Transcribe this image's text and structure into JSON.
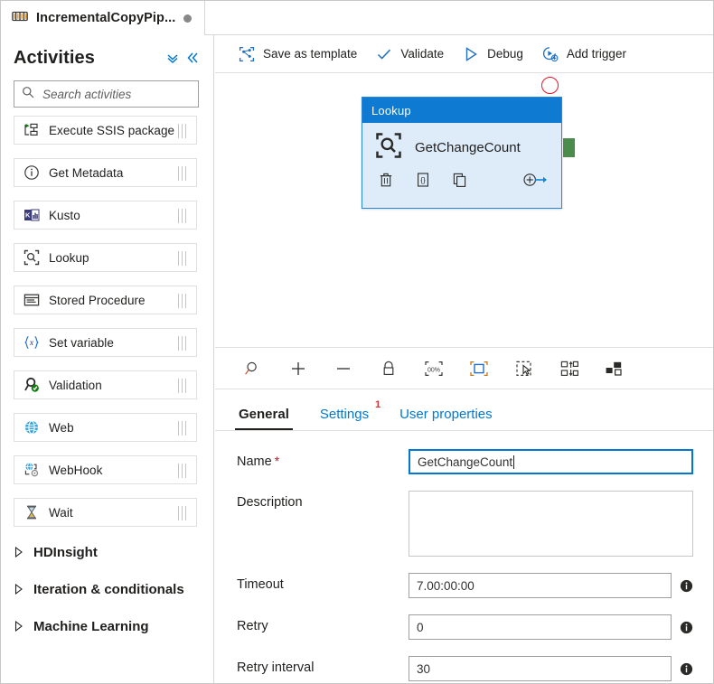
{
  "window": {
    "pipeline_tab_label": "IncrementalCopyPip...",
    "pipeline_tab_icon": "pipeline-icon",
    "unsaved_indicator": "dirty-dot"
  },
  "sidebar": {
    "title": "Activities",
    "collapse_all_icon": "chevron-double-down-icon",
    "collapse_pane_icon": "chevron-double-left-icon",
    "search": {
      "placeholder": "Search activities",
      "value": "",
      "icon": "search-icon"
    },
    "items": [
      {
        "label": "Execute SSIS package",
        "icon": "execute-ssis-package-icon"
      },
      {
        "label": "Get Metadata",
        "icon": "get-metadata-icon"
      },
      {
        "label": "Kusto",
        "icon": "kusto-icon"
      },
      {
        "label": "Lookup",
        "icon": "lookup-icon"
      },
      {
        "label": "Stored Procedure",
        "icon": "stored-procedure-icon"
      },
      {
        "label": "Set variable",
        "icon": "set-variable-icon"
      },
      {
        "label": "Validation",
        "icon": "validation-icon"
      },
      {
        "label": "Web",
        "icon": "web-icon"
      },
      {
        "label": "WebHook",
        "icon": "webhook-icon"
      },
      {
        "label": "Wait",
        "icon": "wait-icon"
      }
    ],
    "groups": [
      {
        "label": "HDInsight",
        "icon": "caret-right-icon"
      },
      {
        "label": "Iteration & conditionals",
        "icon": "caret-right-icon"
      },
      {
        "label": "Machine Learning",
        "icon": "caret-right-icon"
      }
    ]
  },
  "commandbar": {
    "items": [
      {
        "label": "Save as template",
        "icon": "save-as-template-icon"
      },
      {
        "label": "Validate",
        "icon": "checkmark-icon"
      },
      {
        "label": "Debug",
        "icon": "play-triangle-icon"
      },
      {
        "label": "Add trigger",
        "icon": "add-trigger-icon"
      }
    ]
  },
  "canvas": {
    "node": {
      "type_label": "Lookup",
      "name": "GetChangeCount",
      "type_icon": "lookup-icon",
      "actions": [
        {
          "name": "delete-activity",
          "icon": "trash-icon"
        },
        {
          "name": "view-code",
          "icon": "code-brackets-icon"
        },
        {
          "name": "clone-activity",
          "icon": "copy-icon"
        }
      ],
      "add_output_icon": "add-output-arrow-icon",
      "error_badge_icon": "error-circle-icon",
      "output_port_icon": "success-output-port",
      "header_color": "#0f7ad2",
      "body_color": "#deecf9",
      "border_color": "#2b88d8",
      "error_color": "#e81123",
      "port_color": "#4b8b4b"
    }
  },
  "zoombar": {
    "items": [
      {
        "name": "zoom-to-fit",
        "icon": "magnifier-icon"
      },
      {
        "name": "zoom-in",
        "icon": "plus-icon"
      },
      {
        "name": "zoom-out",
        "icon": "minus-icon"
      },
      {
        "name": "lock-canvas",
        "icon": "lock-icon"
      },
      {
        "name": "zoom-100-percent",
        "icon": "zoom-100-icon"
      },
      {
        "name": "fit-to-screen",
        "icon": "fit-screen-icon"
      },
      {
        "name": "selection-mode",
        "icon": "marquee-select-icon"
      },
      {
        "name": "auto-align",
        "icon": "auto-align-icon"
      },
      {
        "name": "toggle-minimap",
        "icon": "minimap-icon"
      }
    ]
  },
  "properties": {
    "tabs": [
      {
        "label": "General",
        "active": true,
        "badge": ""
      },
      {
        "label": "Settings",
        "active": false,
        "badge": "1"
      },
      {
        "label": "User properties",
        "active": false,
        "badge": ""
      }
    ],
    "badge_color": "#d13438",
    "fields": {
      "name": {
        "label": "Name",
        "required": true,
        "required_mark": "*",
        "value": "GetChangeCount",
        "focused": true
      },
      "description": {
        "label": "Description",
        "value": ""
      },
      "timeout": {
        "label": "Timeout",
        "value": "7.00:00:00",
        "info_icon": "info-icon"
      },
      "retry": {
        "label": "Retry",
        "value": "0",
        "info_icon": "info-icon"
      },
      "retry_interval": {
        "label": "Retry interval",
        "value": "30",
        "info_icon": "info-icon"
      }
    }
  }
}
